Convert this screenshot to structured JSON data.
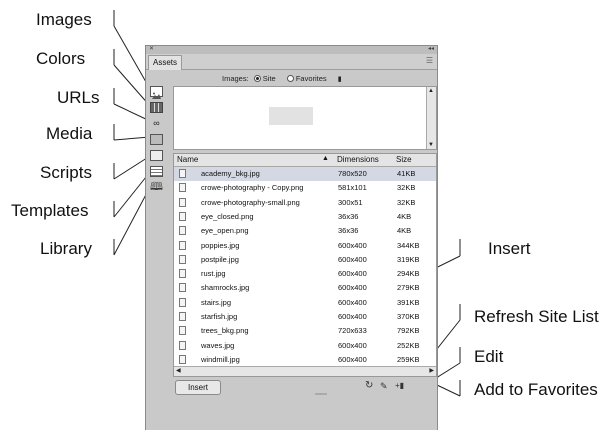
{
  "callouts": {
    "left": [
      "Images",
      "Colors",
      "URLs",
      "Media",
      "Scripts",
      "Templates",
      "Library"
    ],
    "right": {
      "insert": "Insert",
      "refresh": "Refresh Site List",
      "edit": "Edit",
      "add_fav": "Add to Favorites"
    }
  },
  "panel": {
    "tab_label": "Assets",
    "images_label": "Images:",
    "radio_site": "Site",
    "radio_favorites": "Favorites",
    "columns": {
      "name": "Name",
      "dimensions": "Dimensions",
      "size": "Size"
    },
    "files": [
      {
        "name": "academy_bkg.jpg",
        "dimensions": "780x520",
        "size": "41KB"
      },
      {
        "name": "crowe-photography - Copy.png",
        "dimensions": "581x101",
        "size": "32KB"
      },
      {
        "name": "crowe-photography-small.png",
        "dimensions": "300x51",
        "size": "32KB"
      },
      {
        "name": "eye_closed.png",
        "dimensions": "36x36",
        "size": "4KB"
      },
      {
        "name": "eye_open.png",
        "dimensions": "36x36",
        "size": "4KB"
      },
      {
        "name": "poppies.jpg",
        "dimensions": "600x400",
        "size": "344KB"
      },
      {
        "name": "postpile.jpg",
        "dimensions": "600x400",
        "size": "319KB"
      },
      {
        "name": "rust.jpg",
        "dimensions": "600x400",
        "size": "294KB"
      },
      {
        "name": "shamrocks.jpg",
        "dimensions": "600x400",
        "size": "279KB"
      },
      {
        "name": "stairs.jpg",
        "dimensions": "600x400",
        "size": "391KB"
      },
      {
        "name": "starfish.jpg",
        "dimensions": "600x400",
        "size": "370KB"
      },
      {
        "name": "trees_bkg.png",
        "dimensions": "720x633",
        "size": "792KB"
      },
      {
        "name": "waves.jpg",
        "dimensions": "600x400",
        "size": "252KB"
      },
      {
        "name": "windmill.jpg",
        "dimensions": "600x400",
        "size": "259KB"
      }
    ],
    "insert_button": "Insert",
    "selected_row": "academy_bkg.jpg",
    "sidebar_icons": [
      "images-icon",
      "colors-icon",
      "urls-icon",
      "media-icon",
      "scripts-icon",
      "templates-icon",
      "library-icon"
    ]
  }
}
